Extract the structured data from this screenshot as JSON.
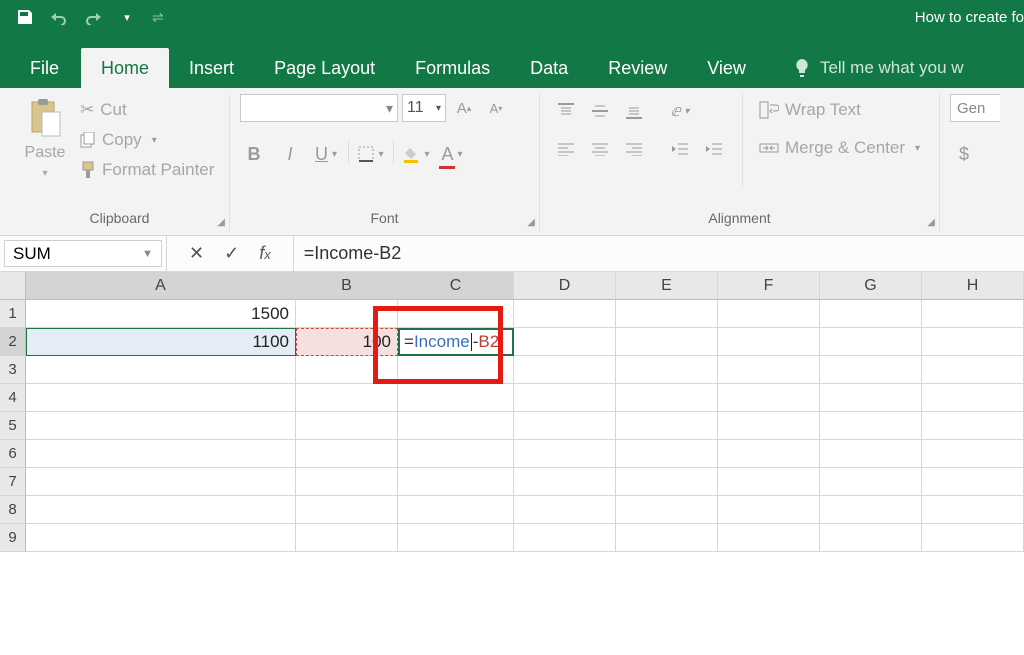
{
  "titlebar": {
    "title": "How to create fo"
  },
  "tabs": {
    "file": "File",
    "home": "Home",
    "insert": "Insert",
    "page_layout": "Page Layout",
    "formulas": "Formulas",
    "data": "Data",
    "review": "Review",
    "view": "View",
    "tell_me": "Tell me what you w"
  },
  "ribbon": {
    "clipboard": {
      "paste": "Paste",
      "cut": "Cut",
      "copy": "Copy",
      "format_painter": "Format Painter",
      "group_label": "Clipboard"
    },
    "font": {
      "size": "11",
      "group_label": "Font"
    },
    "alignment": {
      "wrap_text": "Wrap Text",
      "merge_center": "Merge & Center",
      "group_label": "Alignment"
    },
    "number": {
      "format": "Gen"
    }
  },
  "formula_bar": {
    "name_box": "SUM",
    "formula": "=Income-B2"
  },
  "columns": [
    "A",
    "B",
    "C",
    "D",
    "E",
    "F",
    "G",
    "H"
  ],
  "rows": [
    "1",
    "2",
    "3",
    "4",
    "5",
    "6",
    "7",
    "8",
    "9"
  ],
  "cells": {
    "A1": "1500",
    "A2": "1100",
    "B2": "100",
    "C2_eq": "=",
    "C2_name": "Income",
    "C2_dash": "-",
    "C2_ref": "B2"
  }
}
